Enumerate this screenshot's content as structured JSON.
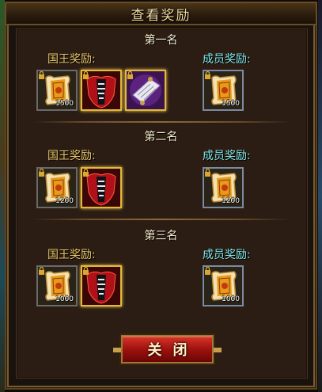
{
  "dialog": {
    "title": "查看奖励",
    "close_label": "关闭"
  },
  "labels": {
    "king": "国王奖励:",
    "member": "成员奖励:"
  },
  "ranks": [
    {
      "title": "第一名",
      "king_items": [
        {
          "icon": "scroll-icon",
          "qty": "1500"
        },
        {
          "icon": "red-armor-icon",
          "qty": ""
        },
        {
          "icon": "purple-scroll-icon",
          "qty": ""
        }
      ],
      "member_items": [
        {
          "icon": "scroll-icon",
          "qty": "1500"
        }
      ]
    },
    {
      "title": "第二名",
      "king_items": [
        {
          "icon": "scroll-icon",
          "qty": "1200"
        },
        {
          "icon": "red-armor-icon",
          "qty": ""
        }
      ],
      "member_items": [
        {
          "icon": "scroll-icon",
          "qty": "1200"
        }
      ]
    },
    {
      "title": "第三名",
      "king_items": [
        {
          "icon": "scroll-icon",
          "qty": "1000"
        },
        {
          "icon": "red-armor-icon",
          "qty": ""
        }
      ],
      "member_items": [
        {
          "icon": "scroll-icon",
          "qty": "1000"
        }
      ]
    }
  ],
  "colors": {
    "king_label": "#e8c66a",
    "member_label": "#7fe8ea",
    "rank_title": "#f5edcf",
    "close_button": "#b81a14"
  }
}
